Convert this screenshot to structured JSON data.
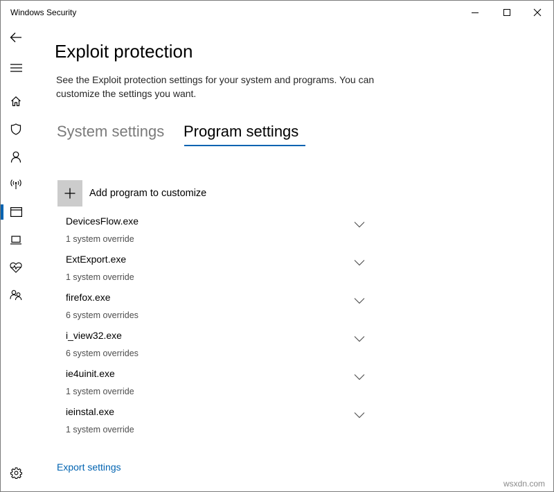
{
  "window": {
    "title": "Windows Security",
    "minimize_icon": "minimize-icon",
    "maximize_icon": "maximize-icon",
    "close_icon": "close-icon"
  },
  "rail": {
    "items": [
      {
        "icon": "back-arrow-icon"
      },
      {
        "icon": "hamburger-menu-icon"
      },
      {
        "icon": "home-icon"
      },
      {
        "icon": "shield-icon"
      },
      {
        "icon": "person-icon"
      },
      {
        "icon": "wireless-antenna-icon"
      },
      {
        "icon": "app-browser-icon",
        "active": true
      },
      {
        "icon": "laptop-icon"
      },
      {
        "icon": "heart-pulse-icon"
      },
      {
        "icon": "family-icon"
      }
    ],
    "settings_icon": "gear-icon",
    "accent_color": "#0063b1"
  },
  "page": {
    "title": "Exploit protection",
    "description": "See the Exploit protection settings for your system and programs.  You can customize the settings you want."
  },
  "tabs": [
    {
      "label": "System settings",
      "selected": false
    },
    {
      "label": "Program settings",
      "selected": true
    }
  ],
  "add_program": {
    "label": "Add program to customize",
    "icon": "plus-icon"
  },
  "programs": [
    {
      "name": "DevicesFlow.exe",
      "overrides": "1 system override"
    },
    {
      "name": "ExtExport.exe",
      "overrides": "1 system override"
    },
    {
      "name": "firefox.exe",
      "overrides": "6 system overrides"
    },
    {
      "name": "i_view32.exe",
      "overrides": "6 system overrides"
    },
    {
      "name": "ie4uinit.exe",
      "overrides": "1 system override"
    },
    {
      "name": "ieinstal.exe",
      "overrides": "1 system override"
    }
  ],
  "export_link": "Export settings",
  "watermark": "wsxdn.com"
}
